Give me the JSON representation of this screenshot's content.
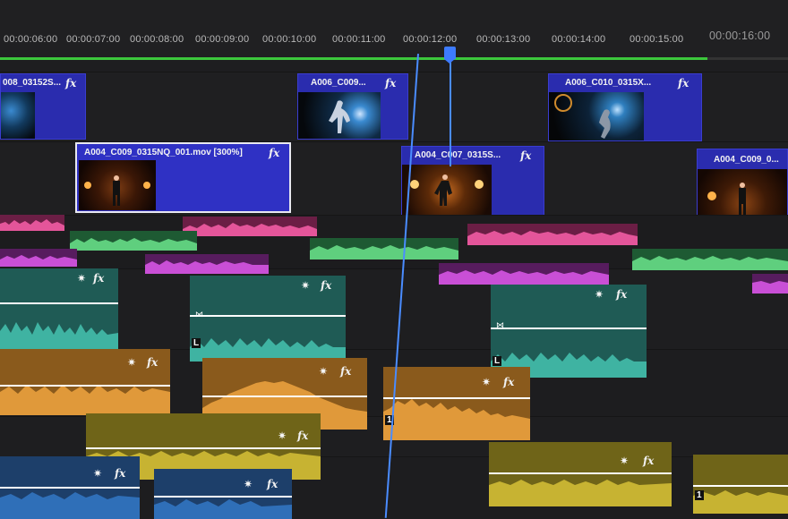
{
  "ruler": {
    "ticks": [
      "00:00:06:00",
      "00:00:07:00",
      "00:00:08:00",
      "00:00:09:00",
      "00:00:10:00",
      "00:00:11:00",
      "00:00:12:00",
      "00:00:13:00",
      "00:00:14:00",
      "00:00:15:00",
      "00:00:16:00"
    ],
    "current_time": "00:00:12:00"
  },
  "colors": {
    "video_clip": "#2a2cae",
    "audio_pink": "#e4559a",
    "audio_green": "#5fcf7e",
    "audio_magenta": "#c94fd6",
    "audio_teal": "#1f6e64",
    "audio_orange": "#e0993a",
    "audio_yellow": "#c7b332",
    "audio_blue": "#2f6fb8",
    "playhead": "#3d7bff",
    "work_area": "#3cc73c"
  },
  "video_track_2": [
    {
      "name": "008_03152S...",
      "fx": "fx"
    },
    {
      "name": "A006_C009...",
      "fx": "fx"
    },
    {
      "name": "A006_C010_0315X...",
      "fx": "fx"
    }
  ],
  "video_track_1": [
    {
      "name": "A004_C009_0315NQ_001.mov [300%]",
      "fx": "fx",
      "selected": true
    },
    {
      "name": "A004_C007_0315S...",
      "fx": "fx"
    },
    {
      "name": "A004_C009_0...",
      "fx": ""
    }
  ],
  "audio_labels": {
    "fx": "fx",
    "star": "✷",
    "clip_channel": "L",
    "clip_channel_num": "1",
    "keyframe": "⋈"
  }
}
